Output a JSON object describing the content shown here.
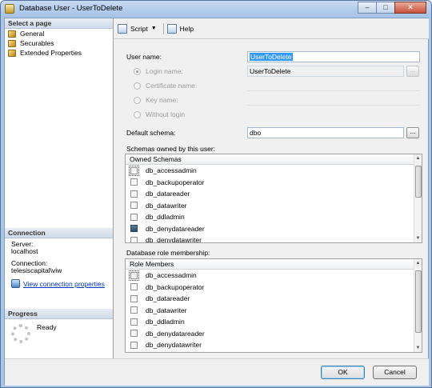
{
  "window": {
    "title": "Database User - UserToDelete",
    "controls": [
      "–",
      "□",
      "✕"
    ]
  },
  "left_pane": {
    "select_page_header": "Select a page",
    "pages": [
      {
        "label": "General",
        "icon": "page-icon"
      },
      {
        "label": "Securables",
        "icon": "page-icon"
      },
      {
        "label": "Extended Properties",
        "icon": "page-icon"
      }
    ],
    "connection_header": "Connection",
    "server_label": "Server:",
    "server_value": "localhost",
    "connection_label": "Connection:",
    "connection_value": "telesiscapital\\viw",
    "view_connection_link": "View connection properties",
    "progress_header": "Progress",
    "progress_status": "Ready"
  },
  "toolbar": {
    "script_label": "Script",
    "help_label": "Help"
  },
  "form": {
    "user_name_label": "User name:",
    "user_name_value": "UserToDelete",
    "login_name_label": "Login name:",
    "login_name_value": "UserToDelete",
    "certificate_name_label": "Certificate name:",
    "key_name_label": "Key name:",
    "without_login_label": "Without login",
    "browse_button_label": "...",
    "default_schema_label": "Default schema:",
    "default_schema_value": "dbo",
    "schemas_owned_label": "Schemas owned by this user:",
    "role_membership_label": "Database role membership:"
  },
  "owned_schemas": {
    "header": "Owned Schemas",
    "rows": [
      {
        "name": "db_accessadmin",
        "checked": false
      },
      {
        "name": "db_backupoperator",
        "checked": false
      },
      {
        "name": "db_datareader",
        "checked": false
      },
      {
        "name": "db_datawriter",
        "checked": false
      },
      {
        "name": "db_ddladmin",
        "checked": false
      },
      {
        "name": "db_denydatareader",
        "checked": true
      },
      {
        "name": "db_denydatawriter",
        "checked": false
      }
    ]
  },
  "role_members": {
    "header": "Role Members",
    "rows": [
      {
        "name": "db_accessadmin",
        "checked": false
      },
      {
        "name": "db_backupoperator",
        "checked": false
      },
      {
        "name": "db_datareader",
        "checked": false
      },
      {
        "name": "db_datawriter",
        "checked": false
      },
      {
        "name": "db_ddladmin",
        "checked": false
      },
      {
        "name": "db_denydatareader",
        "checked": false
      },
      {
        "name": "db_denydatawriter",
        "checked": false
      }
    ]
  },
  "buttons": {
    "ok_label": "OK",
    "cancel_label": "Cancel"
  }
}
